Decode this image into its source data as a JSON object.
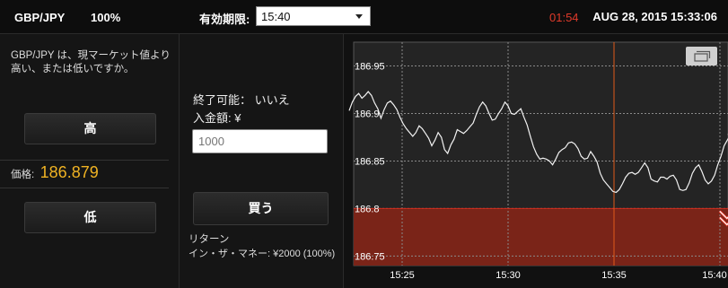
{
  "header": {
    "pair": "GBP/JPY",
    "payout": "100%",
    "expiry_label": "有効期限:",
    "expiry_value": "15:40",
    "countdown": "01:54",
    "datetime": "AUG 28, 2015 15:33:06"
  },
  "left": {
    "question": "GBP/JPY は、現マーケット値より高い、または低いですか。",
    "high_label": "高",
    "low_label": "低",
    "price_label": "価格:",
    "price_value": "186.879"
  },
  "middle": {
    "available": "終了可能： いいえ",
    "deposit_label": "入金額: ¥",
    "amount_placeholder": "1000",
    "buy_label": "買う",
    "return_label": "リターン",
    "return_value": "イン・ザ・マネー: ¥2000 (100%)"
  },
  "colors": {
    "accent_price": "#f0b323",
    "countdown": "#e03a2a",
    "low_zone": "#7a2418",
    "marker": "#e0392a"
  },
  "chart_data": {
    "type": "line",
    "title": "",
    "xlabel": "",
    "ylabel": "",
    "x_ticks": [
      "15:25",
      "15:30",
      "15:35",
      "15:40"
    ],
    "y_ticks": [
      "186.95",
      "186.9",
      "186.85",
      "186.8",
      "186.75"
    ],
    "ylim": [
      186.74,
      186.975
    ],
    "strike": 186.8,
    "expiry_time": "15:35",
    "grid": true,
    "series": [
      {
        "name": "",
        "x": [
          0.0,
          0.15,
          0.3,
          0.45,
          0.6,
          0.75,
          0.9,
          1.05,
          1.2,
          1.35,
          1.5,
          1.65,
          1.8,
          1.95,
          2.1,
          2.25,
          2.4,
          2.55,
          2.7,
          2.85,
          3.0,
          3.15,
          3.3,
          3.45,
          3.6,
          3.75,
          3.9,
          4.05,
          4.2,
          4.35,
          4.5,
          4.65,
          4.8,
          4.95,
          5.1,
          5.25,
          5.4,
          5.55,
          5.7,
          5.85,
          6.0,
          6.15,
          6.3,
          6.45,
          6.6,
          6.75,
          6.9,
          7.05,
          7.2,
          7.35,
          7.5,
          7.65,
          7.8,
          7.95,
          8.1,
          8.25,
          8.4,
          8.55,
          8.7,
          8.85,
          9.0,
          9.15,
          9.3,
          9.45,
          9.6,
          9.75,
          9.9,
          10.05,
          10.2,
          10.35,
          10.5,
          10.65,
          10.8,
          10.95,
          11.1,
          11.25,
          11.4,
          11.55,
          11.7,
          11.85,
          12.0,
          12.15,
          12.3,
          12.45,
          12.6,
          12.75,
          12.9,
          13.05,
          13.2,
          13.35,
          13.5,
          13.65,
          13.8,
          13.95,
          14.1,
          14.25,
          14.4,
          14.55,
          14.7,
          14.85,
          15.0,
          15.15,
          15.3,
          15.45,
          15.6,
          15.75,
          15.9,
          16.05,
          16.2,
          16.35,
          16.5,
          16.65,
          16.8,
          16.95,
          17.1,
          17.25,
          17.4,
          17.55,
          17.7,
          17.85,
          18.0
        ],
        "y": [
          186.903,
          186.912,
          186.918,
          186.921,
          186.916,
          186.919,
          186.923,
          186.919,
          186.911,
          186.905,
          186.895,
          186.904,
          186.911,
          186.913,
          186.909,
          186.904,
          186.896,
          186.889,
          186.884,
          186.88,
          186.876,
          186.88,
          186.887,
          186.884,
          186.879,
          186.874,
          186.866,
          186.872,
          186.88,
          186.875,
          186.862,
          186.858,
          186.867,
          186.873,
          186.883,
          186.881,
          186.879,
          186.882,
          186.886,
          186.89,
          186.899,
          186.907,
          186.912,
          186.908,
          186.9,
          186.893,
          186.894,
          186.9,
          186.905,
          186.912,
          186.908,
          186.9,
          186.899,
          186.902,
          186.905,
          186.896,
          186.888,
          186.876,
          186.865,
          186.857,
          186.852,
          186.853,
          186.852,
          186.85,
          186.846,
          186.852,
          186.859,
          186.862,
          186.864,
          186.869,
          186.87,
          186.868,
          186.863,
          186.855,
          186.852,
          186.853,
          186.86,
          186.855,
          186.849,
          186.837,
          186.83,
          186.826,
          186.822,
          186.818,
          186.817,
          186.82,
          186.826,
          186.833,
          186.837,
          186.838,
          186.836,
          186.838,
          186.843,
          186.848,
          186.843,
          186.831,
          186.829,
          186.828,
          186.833,
          186.833,
          186.831,
          186.834,
          186.835,
          186.83,
          186.82,
          186.819,
          186.82,
          186.827,
          186.837,
          186.843,
          186.846,
          186.839,
          186.83,
          186.826,
          186.829,
          186.835,
          186.846,
          186.855,
          186.866,
          186.872,
          186.878
        ]
      }
    ]
  }
}
